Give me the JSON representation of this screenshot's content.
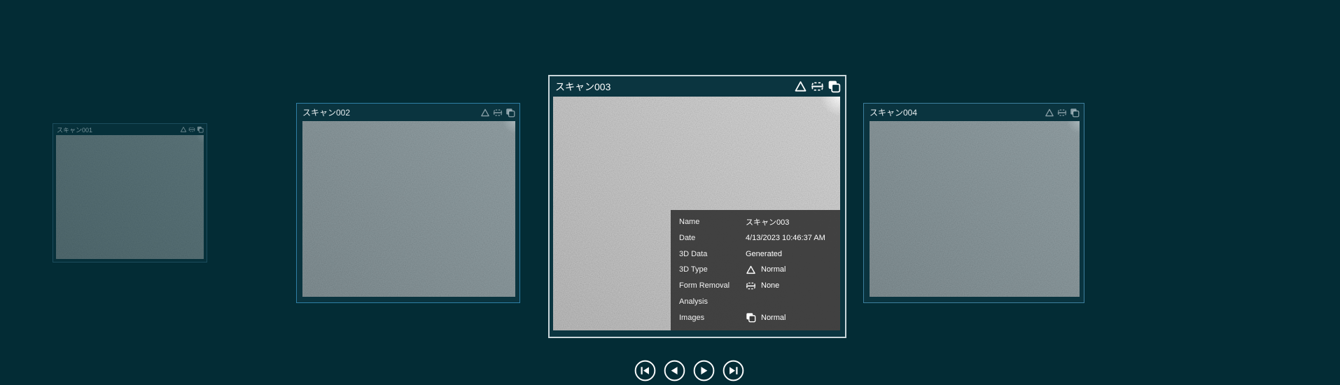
{
  "app": {
    "title": "Scan selection carousel"
  },
  "colors": {
    "background": "#032c35",
    "side_card_border": "#2e7fa6",
    "active_card_border": "#c9d6da",
    "card_header_bg": "#0a343f",
    "info_panel_bg": "#3a3a3a",
    "text_primary": "#ffffff",
    "thumbnail_gray": "#8a8a8a"
  },
  "cards": [
    {
      "title": "スキャン001",
      "state": "inactive-far",
      "icons": [
        "triangle-3d-type-icon",
        "form-removal-icon",
        "images-icon"
      ]
    },
    {
      "title": "スキャン002",
      "state": "inactive",
      "icons": [
        "triangle-3d-type-icon",
        "form-removal-icon",
        "images-icon"
      ]
    },
    {
      "title": "スキャン003",
      "state": "active",
      "icons": [
        "triangle-3d-type-icon",
        "form-removal-icon",
        "images-icon"
      ]
    },
    {
      "title": "スキャン004",
      "state": "inactive",
      "icons": [
        "triangle-3d-type-icon",
        "form-removal-icon",
        "images-icon"
      ]
    }
  ],
  "info_panel": {
    "rows": [
      {
        "label": "Name",
        "value": "スキャン003",
        "icon": ""
      },
      {
        "label": "Date",
        "value": "4/13/2023 10:46:37 AM",
        "icon": ""
      },
      {
        "label": "3D Data",
        "value": "Generated",
        "icon": ""
      },
      {
        "label": "3D Type",
        "value": "Normal",
        "icon": "triangle-3d-type-icon"
      },
      {
        "label": "Form Removal",
        "value": "None",
        "icon": "form-removal-icon"
      },
      {
        "label": "Analysis",
        "value": "",
        "icon": ""
      },
      {
        "label": "Images",
        "value": "Normal",
        "icon": "images-icon"
      }
    ]
  },
  "navigation": {
    "buttons": [
      {
        "name": "first",
        "symbol": "skip-to-first"
      },
      {
        "name": "previous",
        "symbol": "previous"
      },
      {
        "name": "next",
        "symbol": "next"
      },
      {
        "name": "last",
        "symbol": "skip-to-last"
      }
    ]
  }
}
